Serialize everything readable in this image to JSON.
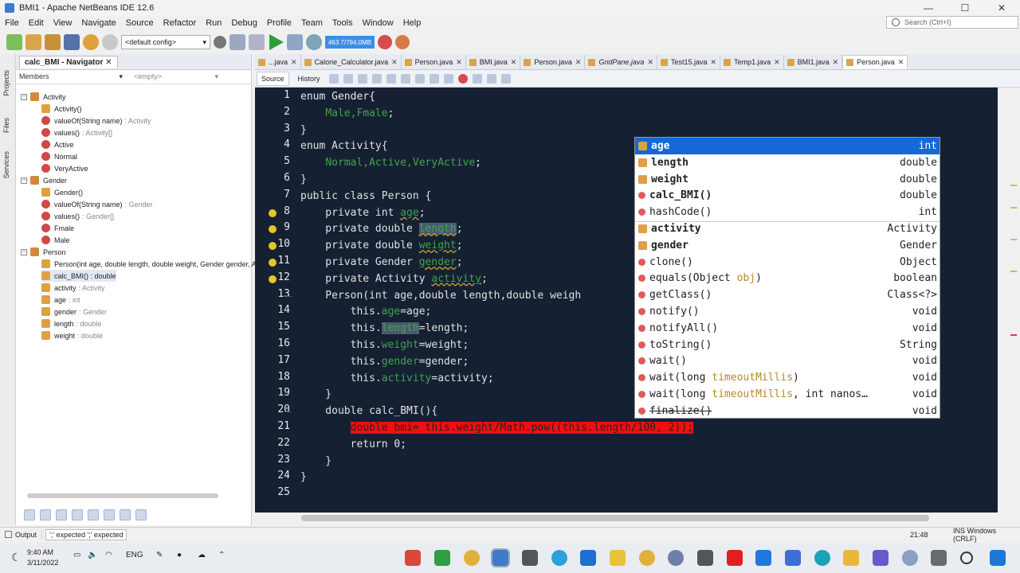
{
  "window": {
    "title": "BMI1 - Apache NetBeans IDE 12.6",
    "min": "—",
    "max": "☐",
    "close": "✕"
  },
  "menu": [
    "File",
    "Edit",
    "View",
    "Navigate",
    "Source",
    "Refactor",
    "Run",
    "Debug",
    "Profile",
    "Team",
    "Tools",
    "Window",
    "Help"
  ],
  "search": {
    "placeholder": "Search (Ctrl+I)"
  },
  "toolbar": {
    "config": "<default config>",
    "memory": "463.7/794.0MB"
  },
  "side_tabs": [
    "Projects",
    "Files",
    "Services"
  ],
  "navigator": {
    "tab": "calc_BMI - Navigator",
    "close": "✕",
    "filter_left": "Members",
    "filter_right": "<empty>",
    "items": [
      {
        "label": "Activity",
        "type": "",
        "level": 0,
        "kind": "enum"
      },
      {
        "label": "Activity()",
        "type": "",
        "level": 1,
        "kind": "method"
      },
      {
        "label": "valueOf(String name)",
        "type": ": Activity",
        "level": 1,
        "kind": "static"
      },
      {
        "label": "values()",
        "type": ": Activity[]",
        "level": 1,
        "kind": "static"
      },
      {
        "label": "Active",
        "type": "",
        "level": 1,
        "kind": "const"
      },
      {
        "label": "Normal",
        "type": "",
        "level": 1,
        "kind": "const"
      },
      {
        "label": "VeryActive",
        "type": "",
        "level": 1,
        "kind": "const"
      },
      {
        "label": "Gender",
        "type": "",
        "level": 0,
        "kind": "enum"
      },
      {
        "label": "Gender()",
        "type": "",
        "level": 1,
        "kind": "method"
      },
      {
        "label": "valueOf(String name)",
        "type": ": Gender",
        "level": 1,
        "kind": "static"
      },
      {
        "label": "values()",
        "type": ": Gender[]",
        "level": 1,
        "kind": "static"
      },
      {
        "label": "Fmale",
        "type": "",
        "level": 1,
        "kind": "const"
      },
      {
        "label": "Male",
        "type": "",
        "level": 1,
        "kind": "const"
      },
      {
        "label": "Person",
        "type": "",
        "level": 0,
        "kind": "class"
      },
      {
        "label": "Person(int age, double length, double weight, Gender gender, A",
        "type": "",
        "level": 1,
        "kind": "method"
      },
      {
        "label": "calc_BMI() : double",
        "type": "",
        "level": 1,
        "kind": "method",
        "selected": true
      },
      {
        "label": "activity",
        "type": ": Activity",
        "level": 1,
        "kind": "field"
      },
      {
        "label": "age",
        "type": ": int",
        "level": 1,
        "kind": "field"
      },
      {
        "label": "gender",
        "type": ": Gender",
        "level": 1,
        "kind": "field"
      },
      {
        "label": "length",
        "type": ": double",
        "level": 1,
        "kind": "field"
      },
      {
        "label": "weight",
        "type": ": double",
        "level": 1,
        "kind": "field"
      }
    ]
  },
  "editor_tabs": [
    {
      "label": "...java",
      "active": false
    },
    {
      "label": "Calorie_Calculator.java",
      "active": false
    },
    {
      "label": "Person.java",
      "active": false
    },
    {
      "label": "BMI.java",
      "active": false
    },
    {
      "label": "Person.java",
      "active": false
    },
    {
      "label": "GridPane.java",
      "active": false
    },
    {
      "label": "Test15.java",
      "active": false
    },
    {
      "label": "Temp1.java",
      "active": false
    },
    {
      "label": "BMI1.java",
      "active": false
    },
    {
      "label": "Person.java",
      "active": true
    }
  ],
  "editor_subtabs": {
    "source": "Source",
    "history": "History"
  },
  "code_lines": [
    "1",
    "2",
    "3",
    "4",
    "5",
    "6",
    "7",
    "8",
    "9",
    "10",
    "11",
    "12",
    "13",
    "14",
    "15",
    "16",
    "17",
    "18",
    "19",
    "20",
    "21",
    "22",
    "23",
    "24",
    "25"
  ],
  "code": [
    [
      {
        "t": "enum Gender{",
        "c": "kw"
      }
    ],
    [
      {
        "t": "    "
      },
      {
        "t": "Male,Fmale",
        "c": "fld"
      },
      {
        "t": ";"
      }
    ],
    [
      {
        "t": "}"
      }
    ],
    [
      {
        "t": "enum Activity{"
      }
    ],
    [
      {
        "t": "    "
      },
      {
        "t": "Normal,Active,VeryActive",
        "c": "fld"
      },
      {
        "t": ";"
      }
    ],
    [
      {
        "t": "}"
      }
    ],
    [
      {
        "t": "public class Person {"
      }
    ],
    [
      {
        "t": "    private int "
      },
      {
        "t": "age",
        "c": "fld warnul"
      },
      {
        "t": ";"
      }
    ],
    [
      {
        "t": "    private double "
      },
      {
        "t": "length",
        "c": "fld warnul hl"
      },
      {
        "t": ";"
      }
    ],
    [
      {
        "t": "    private double "
      },
      {
        "t": "weight",
        "c": "fld warnul"
      },
      {
        "t": ";"
      }
    ],
    [
      {
        "t": "    private Gender "
      },
      {
        "t": "gender",
        "c": "fld warnul"
      },
      {
        "t": ";"
      }
    ],
    [
      {
        "t": "    private Activity "
      },
      {
        "t": "activity",
        "c": "fld warnul"
      },
      {
        "t": ";"
      }
    ],
    [
      {
        "t": "    Person(int age,double length,double weigh"
      }
    ],
    [
      {
        "t": "        this."
      },
      {
        "t": "age",
        "c": "fld"
      },
      {
        "t": "=age;"
      }
    ],
    [
      {
        "t": "        this."
      },
      {
        "t": "length",
        "c": "fld hl"
      },
      {
        "t": "=length;"
      }
    ],
    [
      {
        "t": "        this."
      },
      {
        "t": "weight",
        "c": "fld"
      },
      {
        "t": "=weight;"
      }
    ],
    [
      {
        "t": "        this."
      },
      {
        "t": "gender",
        "c": "fld"
      },
      {
        "t": "=gender;"
      }
    ],
    [
      {
        "t": "        this."
      },
      {
        "t": "activity",
        "c": "fld"
      },
      {
        "t": "=activity;"
      }
    ],
    [
      {
        "t": "    }"
      }
    ],
    [
      {
        "t": "    double calc_BMI(){"
      }
    ],
    [
      {
        "t": "        "
      },
      {
        "t": "double bmi= this.weight/Math.pow((this.length/100, 2));",
        "c": "errline"
      }
    ],
    [
      {
        "t": "        return 0;"
      }
    ],
    [
      {
        "t": "    }"
      }
    ],
    [
      {
        "t": "}"
      }
    ],
    [
      {
        "t": ""
      }
    ]
  ],
  "completion": [
    {
      "name": "age",
      "type": "int",
      "bold": true,
      "selected": true,
      "icon": "field-icon"
    },
    {
      "name": "length",
      "type": "double",
      "bold": true,
      "icon": "field-icon"
    },
    {
      "name": "weight",
      "type": "double",
      "bold": true,
      "icon": "field-icon"
    },
    {
      "name": "calc_BMI()",
      "type": "double",
      "bold": true,
      "icon": "method-icon"
    },
    {
      "name": "hashCode()",
      "type": "int",
      "icon": "method-icon"
    },
    {
      "name": "activity",
      "type": "Activity",
      "bold": true,
      "icon": "field-icon"
    },
    {
      "name": "gender",
      "type": "Gender",
      "bold": true,
      "icon": "field-icon"
    },
    {
      "name": "clone()",
      "type": "Object",
      "icon": "method-icon"
    },
    {
      "name": "equals(Object ",
      "param": "obj",
      "tail": ")",
      "type": "boolean",
      "icon": "method-icon"
    },
    {
      "name": "getClass()",
      "type": "Class<?>",
      "icon": "method-icon"
    },
    {
      "name": "notify()",
      "type": "void",
      "icon": "method-icon"
    },
    {
      "name": "notifyAll()",
      "type": "void",
      "icon": "method-icon"
    },
    {
      "name": "toString()",
      "type": "String",
      "icon": "method-icon"
    },
    {
      "name": "wait()",
      "type": "void",
      "icon": "method-icon"
    },
    {
      "name": "wait(long ",
      "param": "timeoutMillis",
      "tail": ")",
      "type": "void",
      "icon": "method-icon"
    },
    {
      "name": "wait(long ",
      "param": "timeoutMillis",
      "tail": ", int nanos…",
      "type": "void",
      "icon": "method-icon"
    },
    {
      "name": "finalize()",
      "type": "void",
      "strike": true,
      "icon": "method-icon"
    }
  ],
  "status": {
    "output": "Output",
    "message": "';' expected   ';' expected",
    "position": "21:48",
    "mode": "INS Windows (CRLF)"
  },
  "taskbar": {
    "time": "9:40 AM",
    "date": "3/11/2022",
    "lang": "ENG"
  },
  "colors": {
    "selection": "#1568d6",
    "editor_bg": "#162033",
    "error": "#f00f0f",
    "field": "#3fa54a"
  }
}
